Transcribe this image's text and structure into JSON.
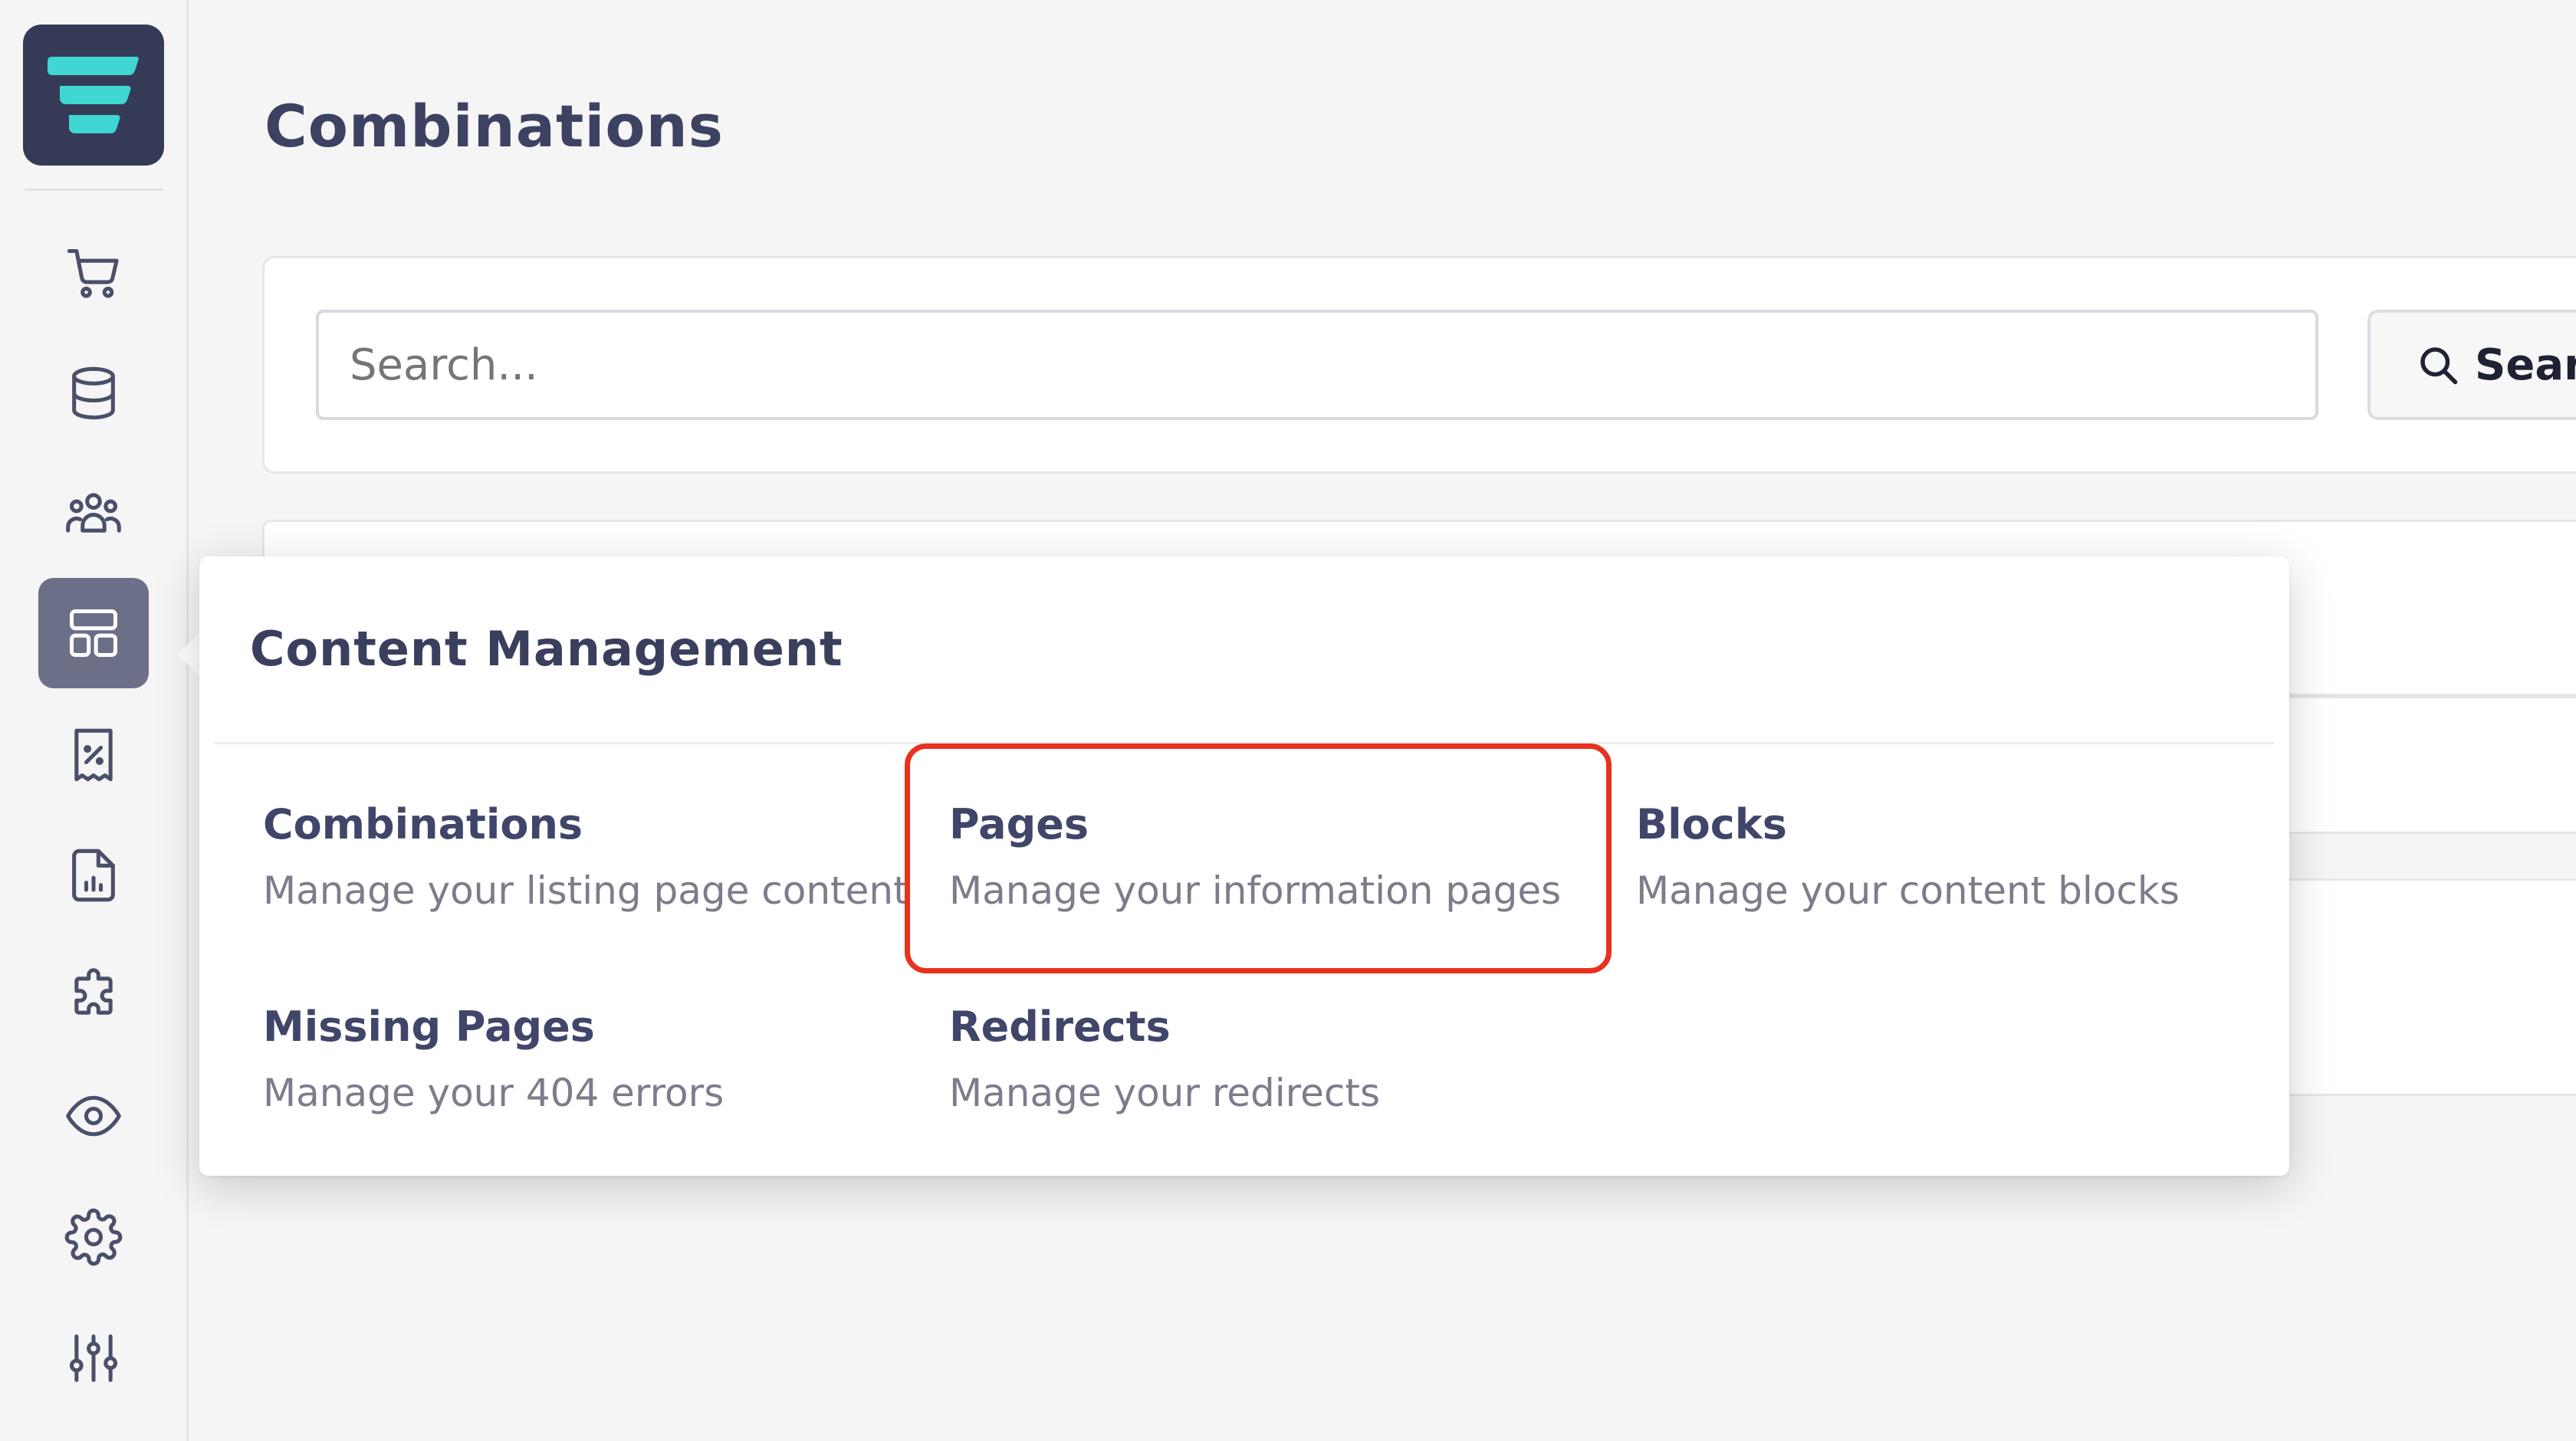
{
  "page": {
    "title": "Combinations"
  },
  "sidebar": {
    "items": [
      {
        "icon": "cart-icon",
        "label": ""
      },
      {
        "icon": "database-icon",
        "label": ""
      },
      {
        "icon": "users-icon",
        "label": ""
      },
      {
        "icon": "layout-icon",
        "label": "",
        "active": true
      },
      {
        "icon": "receipt-percent-icon",
        "label": ""
      },
      {
        "icon": "report-icon",
        "label": ""
      },
      {
        "icon": "puzzle-icon",
        "label": ""
      },
      {
        "icon": "eye-icon",
        "label": ""
      },
      {
        "icon": "gear-icon",
        "label": ""
      },
      {
        "icon": "sliders-icon",
        "label": ""
      }
    ]
  },
  "search": {
    "placeholder": "Search...",
    "button_label": "Search"
  },
  "flyout": {
    "title": "Content Management",
    "items": [
      {
        "label": "Combinations",
        "description": "Manage your listing page content"
      },
      {
        "label": "Pages",
        "description": "Manage your information pages"
      },
      {
        "label": "Blocks",
        "description": "Manage your content blocks"
      },
      {
        "label": "Missing Pages",
        "description": "Manage your 404 errors"
      },
      {
        "label": "Redirects",
        "description": "Manage your redirects"
      }
    ]
  },
  "colors": {
    "logo_bg": "#353b56",
    "logo_accent": "#3fd6d3",
    "active_nav": "#6b6f87",
    "highlight": "#e8321e",
    "text_primary": "#3d4262",
    "text_secondary": "#7b7d8b"
  }
}
